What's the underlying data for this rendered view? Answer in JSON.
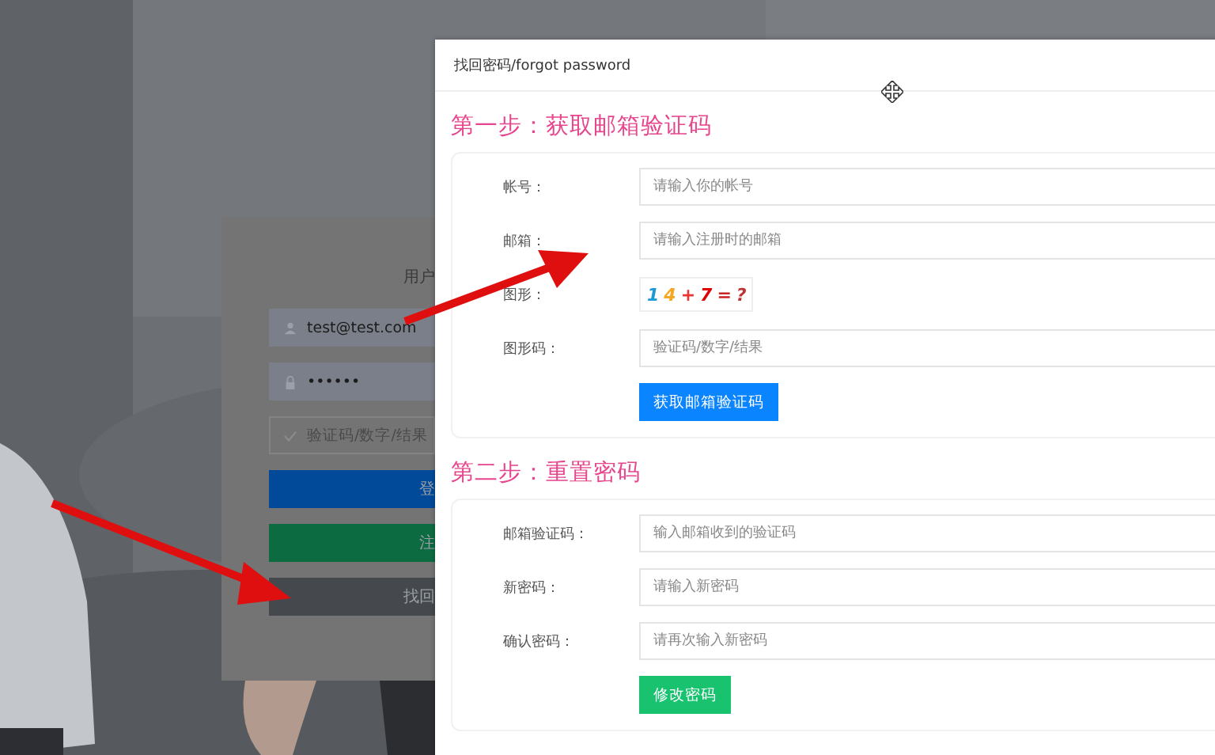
{
  "login_card": {
    "title": "用户",
    "fields": [
      {
        "kind": "user",
        "value": "test@test.com"
      },
      {
        "kind": "password",
        "value": "••••••"
      },
      {
        "kind": "code",
        "placeholder": "验证码/数字/结果"
      }
    ],
    "buttons": [
      {
        "kind": "primary",
        "label": "登"
      },
      {
        "kind": "success",
        "label": "注"
      },
      {
        "kind": "default",
        "label": "找回"
      }
    ]
  },
  "dialog": {
    "title": "找回密码/forgot password",
    "steps": [
      {
        "heading": "第一步：获取邮箱验证码",
        "rows": [
          {
            "kind": "input",
            "label": "帐号：",
            "placeholder": "请输入你的帐号"
          },
          {
            "kind": "input",
            "label": "邮箱：",
            "placeholder": "请输入注册时的邮箱"
          },
          {
            "kind": "captcha",
            "label": "图形：",
            "captcha": "14+7=?"
          },
          {
            "kind": "input",
            "label": "图形码：",
            "placeholder": "验证码/数字/结果"
          }
        ],
        "button": {
          "kind": "primary",
          "label": "获取邮箱验证码"
        }
      },
      {
        "heading": "第二步：重置密码",
        "rows": [
          {
            "kind": "input",
            "label": "邮箱验证码：",
            "placeholder": "输入邮箱收到的验证码"
          },
          {
            "kind": "input",
            "label": "新密码：",
            "placeholder": "请输入新密码"
          },
          {
            "kind": "input",
            "label": "确认密码：",
            "placeholder": "请再次输入新密码"
          }
        ],
        "button": {
          "kind": "success",
          "label": "修改密码"
        }
      }
    ]
  }
}
